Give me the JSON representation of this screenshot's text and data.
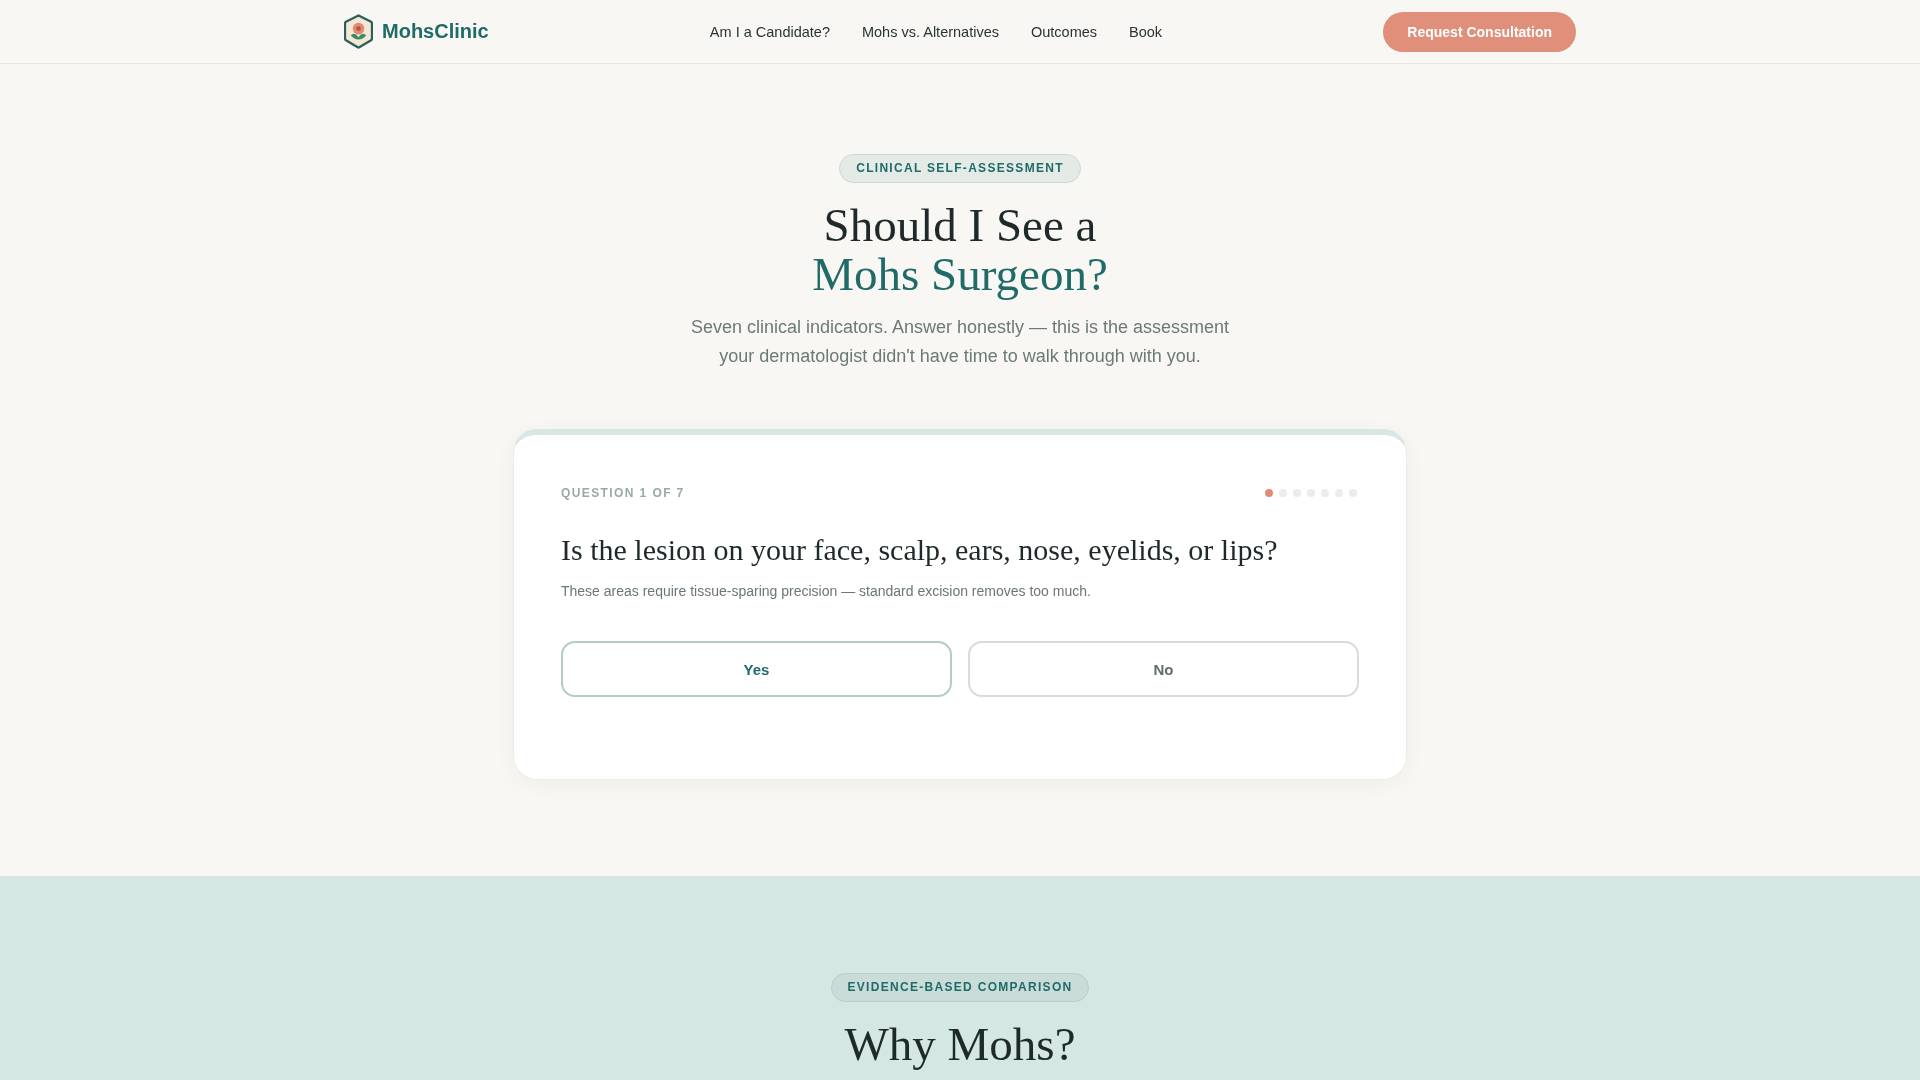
{
  "header": {
    "logo": {
      "text": "MohsClinic"
    },
    "nav": [
      {
        "label": "Am I a Candidate?"
      },
      {
        "label": "Mohs vs. Alternatives"
      },
      {
        "label": "Outcomes"
      },
      {
        "label": "Book"
      }
    ],
    "cta": "Request Consultation"
  },
  "hero": {
    "badge": "CLINICAL SELF-ASSESSMENT",
    "title": "Should I See a",
    "title_accent": "Mohs Surgeon?",
    "subtitle": "Seven clinical indicators. Answer honestly — this is the assessment your dermatologist didn't have time to walk through with you."
  },
  "quiz": {
    "counter": "QUESTION 1 OF 7",
    "steps": [
      {
        "active": true
      },
      {
        "active": false
      },
      {
        "active": false
      },
      {
        "active": false
      },
      {
        "active": false
      },
      {
        "active": false
      },
      {
        "active": false
      }
    ],
    "question": "Is the lesion on your face, scalp, ears, nose, eyelids, or lips?",
    "hint": "These areas require tissue-sparing precision — standard excision removes too much.",
    "options": [
      {
        "label": "Yes",
        "selected": true
      },
      {
        "label": "No",
        "selected": false
      }
    ]
  },
  "comparison": {
    "badge": "EVIDENCE-BASED COMPARISON",
    "title": "Why Mohs?"
  }
}
